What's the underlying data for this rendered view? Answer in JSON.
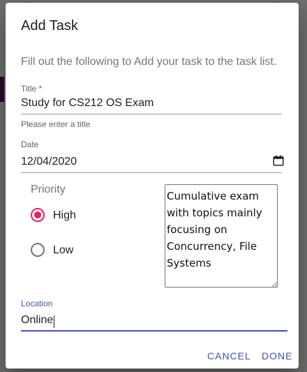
{
  "dialog": {
    "title": "Add Task",
    "description": "Fill out the following to Add your task to the task list."
  },
  "fields": {
    "title": {
      "label": "Title *",
      "value": "Study for CS212 OS Exam",
      "helper": "Please enter a title"
    },
    "date": {
      "label": "Date",
      "value": "12/04/2020"
    },
    "location": {
      "label": "Location",
      "value": "Online"
    }
  },
  "priority": {
    "label": "Priority",
    "options": [
      {
        "label": "High",
        "checked": true
      },
      {
        "label": "Low",
        "checked": false
      }
    ]
  },
  "notes": {
    "value": "Cumulative exam with topics mainly focusing on Concurrency, File Systems"
  },
  "actions": {
    "cancel": "CANCEL",
    "done": "DONE"
  },
  "colors": {
    "accent": "#3f51b5",
    "radio_checked": "#e91e63"
  },
  "icons": {
    "date_picker": "calendar-icon",
    "notes_resize": "resize-grip-icon"
  }
}
